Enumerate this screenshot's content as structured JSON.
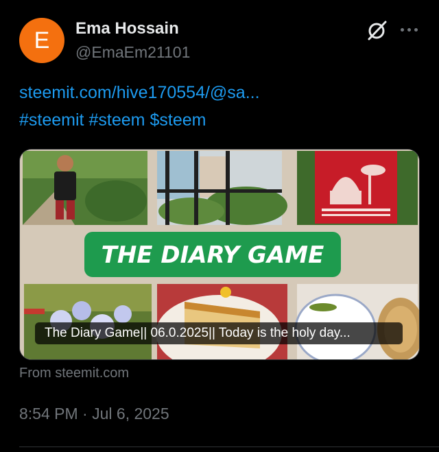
{
  "author": {
    "avatar_letter": "E",
    "avatar_color": "#f4700f",
    "display_name": "Ema Hossain",
    "handle": "@EmaEm21101"
  },
  "post": {
    "link_text": "steemit.com/hive170554/@sa...",
    "hashtags": [
      "#steemit",
      "#steem",
      "$steem"
    ]
  },
  "link_card": {
    "banner_text": "THE DIARY GAME",
    "title": "The Diary Game|| 06.0.2025|| Today is the holy day...",
    "source_prefix": "From",
    "source_domain": "steemit.com"
  },
  "meta": {
    "time": "8:54 PM",
    "separator": "·",
    "date": "Jul 6, 2025"
  },
  "colors": {
    "background": "#000000",
    "text_primary": "#e7e9ea",
    "text_secondary": "#71767b",
    "link": "#1d9bf0",
    "banner_green": "#1e9b4e"
  },
  "icons": {
    "grok": "grok-icon",
    "more": "more-horizontal-icon"
  }
}
